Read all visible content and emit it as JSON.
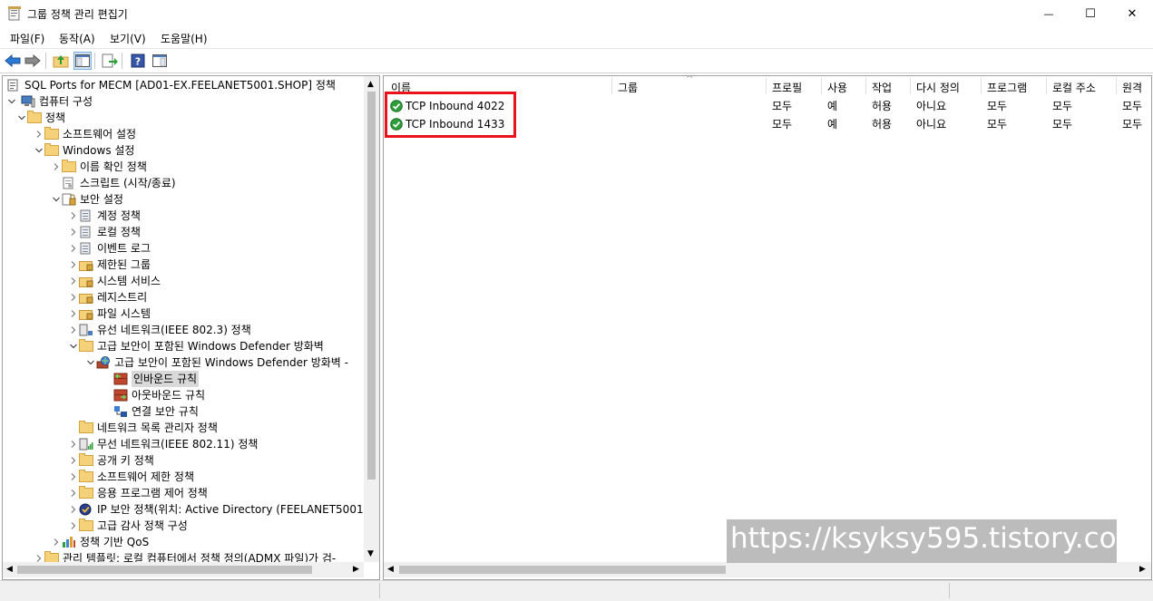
{
  "window": {
    "title": "그룹 정책 관리 편집기",
    "minimize_glyph": "—",
    "maximize_glyph": "☐",
    "close_glyph": "✕"
  },
  "menu": [
    "파일(F)",
    "동작(A)",
    "보기(V)",
    "도움말(H)"
  ],
  "toolbar_icons": [
    "back-arrow-icon",
    "forward-arrow-icon",
    "up-folder-icon",
    "show-hide-tree-icon",
    "export-list-icon",
    "help-icon",
    "show-action-pane-icon"
  ],
  "tree": [
    {
      "label": "SQL Ports for MECM [AD01-EX.FEELANET5001.SHOP] 정책",
      "depth": 0,
      "chevron": "",
      "icon": "policy-doc-icon"
    },
    {
      "label": "컴퓨터 구성",
      "depth": 0,
      "chevron": "v",
      "icon": "computer-icon"
    },
    {
      "label": "정책",
      "depth": 1,
      "chevron": "v",
      "icon": "folder-icon"
    },
    {
      "label": "소프트웨어 설정",
      "depth": 2,
      "chevron": ">",
      "icon": "folder-icon"
    },
    {
      "label": "Windows 설정",
      "depth": 2,
      "chevron": "v",
      "icon": "folder-icon"
    },
    {
      "label": "이름 확인 정책",
      "depth": 3,
      "chevron": ">",
      "icon": "folder-icon"
    },
    {
      "label": "스크립트 (시작/종료)",
      "depth": 3,
      "chevron": "",
      "icon": "script-icon"
    },
    {
      "label": "보안 설정",
      "depth": 3,
      "chevron": "v",
      "icon": "security-settings-icon"
    },
    {
      "label": "계정 정책",
      "depth": 4,
      "chevron": ">",
      "icon": "policy-book-icon"
    },
    {
      "label": "로컬 정책",
      "depth": 4,
      "chevron": ">",
      "icon": "policy-book-icon"
    },
    {
      "label": "이벤트 로그",
      "depth": 4,
      "chevron": ">",
      "icon": "policy-book-icon"
    },
    {
      "label": "제한된 그룹",
      "depth": 4,
      "chevron": ">",
      "icon": "locked-folder-icon"
    },
    {
      "label": "시스템 서비스",
      "depth": 4,
      "chevron": ">",
      "icon": "locked-folder-icon"
    },
    {
      "label": "레지스트리",
      "depth": 4,
      "chevron": ">",
      "icon": "locked-folder-icon"
    },
    {
      "label": "파일 시스템",
      "depth": 4,
      "chevron": ">",
      "icon": "locked-folder-icon"
    },
    {
      "label": "유선 네트워크(IEEE 802.3) 정책",
      "depth": 4,
      "chevron": ">",
      "icon": "wired-network-icon"
    },
    {
      "label": "고급 보안이 포함된 Windows Defender 방화벽",
      "depth": 4,
      "chevron": "v",
      "icon": "folder-icon"
    },
    {
      "label": "고급 보안이 포함된 Windows Defender 방화벽 -",
      "depth": 5,
      "chevron": "v",
      "icon": "firewall-globe-icon"
    },
    {
      "label": "인바운드 규칙",
      "depth": 6,
      "chevron": "",
      "icon": "inbound-rules-icon",
      "selected": true
    },
    {
      "label": "아웃바운드 규칙",
      "depth": 6,
      "chevron": "",
      "icon": "outbound-rules-icon"
    },
    {
      "label": "연결 보안 규칙",
      "depth": 6,
      "chevron": "",
      "icon": "connection-security-icon"
    },
    {
      "label": "네트워크 목록 관리자 정책",
      "depth": 4,
      "chevron": "",
      "icon": "folder-icon"
    },
    {
      "label": "무선 네트워크(IEEE 802.11) 정책",
      "depth": 4,
      "chevron": ">",
      "icon": "wireless-network-icon"
    },
    {
      "label": "공개 키 정책",
      "depth": 4,
      "chevron": ">",
      "icon": "folder-icon"
    },
    {
      "label": "소프트웨어 제한 정책",
      "depth": 4,
      "chevron": ">",
      "icon": "folder-icon"
    },
    {
      "label": "응용 프로그램 제어 정책",
      "depth": 4,
      "chevron": ">",
      "icon": "folder-icon"
    },
    {
      "label": "IP 보안 정책(위치: Active Directory (FEELANET5001.",
      "depth": 4,
      "chevron": ">",
      "icon": "ip-security-icon"
    },
    {
      "label": "고급 감사 정책 구성",
      "depth": 4,
      "chevron": ">",
      "icon": "folder-icon"
    },
    {
      "label": "정책 기반 QoS",
      "depth": 3,
      "chevron": ">",
      "icon": "qos-chart-icon"
    },
    {
      "label": "관리 템플릿: 로컬 컴퓨터에서 정책 정의(ADMX 파일)가 검-",
      "depth": 2,
      "chevron": ">",
      "icon": "folder-icon"
    }
  ],
  "columns": [
    "이름",
    "그룹",
    "프로필",
    "사용",
    "작업",
    "다시 정의",
    "프로그램",
    "로컬 주소",
    "원격"
  ],
  "sort_glyph": "^",
  "rules": [
    {
      "name": "TCP Inbound 4022",
      "group": "",
      "profile": "모두",
      "enabled": "예",
      "action": "허용",
      "override": "아니요",
      "program": "모두",
      "local_address": "모두",
      "remote": "모두"
    },
    {
      "name": "TCP Inbound 1433",
      "group": "",
      "profile": "모두",
      "enabled": "예",
      "action": "허용",
      "override": "아니요",
      "program": "모두",
      "local_address": "모두",
      "remote": "모두"
    }
  ],
  "watermark": "https://ksyksy595.tistory.com",
  "colors": {
    "highlight": "#e8131b",
    "enabled_check": "#2e9e3a",
    "toolbar_arrow": "#2a78d6"
  }
}
